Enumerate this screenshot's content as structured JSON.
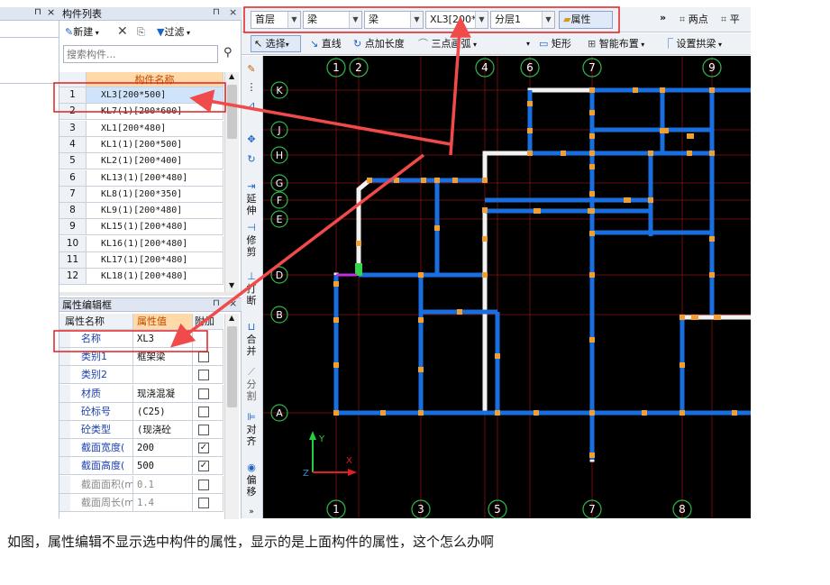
{
  "left_panel": {
    "title": "构件列表",
    "pin": "⊓",
    "close": "×",
    "new_label": "新建",
    "filter_label": "过滤",
    "search_placeholder": "搜索构件...",
    "column_header": "构件名称",
    "rows": [
      {
        "num": "1",
        "name": "XL3[200*500]"
      },
      {
        "num": "2",
        "name": "KL7(1)[200*600]"
      },
      {
        "num": "3",
        "name": "XL1[200*480]"
      },
      {
        "num": "4",
        "name": "KL1(1)[200*500]"
      },
      {
        "num": "5",
        "name": "KL2(1)[200*400]"
      },
      {
        "num": "6",
        "name": "KL13(1)[200*480]"
      },
      {
        "num": "7",
        "name": "KL8(1)[200*350]"
      },
      {
        "num": "8",
        "name": "KL9(1)[200*480]"
      },
      {
        "num": "9",
        "name": "KL15(1)[200*480]"
      },
      {
        "num": "10",
        "name": "KL16(1)[200*480]"
      },
      {
        "num": "11",
        "name": "KL17(1)[200*480]"
      },
      {
        "num": "12",
        "name": "KL18(1)[200*480]"
      }
    ]
  },
  "prop_panel": {
    "title": "属性编辑框",
    "headers": [
      "属性名称",
      "属性值",
      "附加"
    ],
    "rows": [
      {
        "name": "名称",
        "value": "XL3",
        "checkbox": false,
        "has_checkbox": false,
        "dim": false
      },
      {
        "name": "类别1",
        "value": "框架梁",
        "checkbox": false,
        "has_checkbox": true,
        "dim": false
      },
      {
        "name": "类别2",
        "value": "",
        "checkbox": false,
        "has_checkbox": true,
        "dim": false
      },
      {
        "name": "材质",
        "value": "现浇混凝",
        "checkbox": false,
        "has_checkbox": true,
        "dim": false
      },
      {
        "name": "砼标号",
        "value": "(C25)",
        "checkbox": false,
        "has_checkbox": true,
        "dim": false
      },
      {
        "name": "砼类型",
        "value": "(现浇砼",
        "checkbox": false,
        "has_checkbox": true,
        "dim": false
      },
      {
        "name": "截面宽度(",
        "value": "200",
        "checkbox": true,
        "has_checkbox": true,
        "dim": false
      },
      {
        "name": "截面高度(",
        "value": "500",
        "checkbox": true,
        "has_checkbox": true,
        "dim": false
      },
      {
        "name": "截面面积(m",
        "value": "0.1",
        "checkbox": false,
        "has_checkbox": true,
        "dim": true
      },
      {
        "name": "截面周长(m",
        "value": "1.4",
        "checkbox": false,
        "has_checkbox": true,
        "dim": true
      }
    ]
  },
  "toolbar1": {
    "floor": "首层",
    "type1": "梁",
    "type2": "梁",
    "component": "XL3[200*",
    "layer": "分层1",
    "property_btn": "属性",
    "more": "»",
    "two_point": "两点",
    "parallel": "平"
  },
  "toolbar2": {
    "select": "选择",
    "line": "直线",
    "point_length": "点加长度",
    "three_point_arc": "三点画弧",
    "rect": "矩形",
    "smart_layout": "智能布置",
    "set_arch_beam": "设置拱梁"
  },
  "vertical_tools": [
    {
      "label": "延\n伸"
    },
    {
      "label": "修\n剪"
    },
    {
      "label": "打\n断"
    },
    {
      "label": "合\n并"
    },
    {
      "label": "分\n割"
    },
    {
      "label": "对\n齐"
    },
    {
      "label": "偏\n移"
    }
  ],
  "axes": {
    "top": [
      "1",
      "2",
      "4",
      "6",
      "7",
      "9"
    ],
    "bottom": [
      "1",
      "3",
      "5",
      "7",
      "8"
    ],
    "left": [
      "K",
      "J",
      "H",
      "G",
      "F",
      "E",
      "D",
      "B",
      "A"
    ]
  },
  "coord": {
    "x": "X",
    "y": "Y",
    "z": "Z"
  },
  "caption": "如图，属性编辑不显示选中构件的属性，显示的是上面构件的属性，这个怎么办啊",
  "colors": {
    "canvas_bg": "#000000",
    "beam_blue": "#1a6fe0",
    "highlight_red": "#e02020",
    "arrow_red": "#f04a4a",
    "header_orange": "#ffd9a8"
  }
}
